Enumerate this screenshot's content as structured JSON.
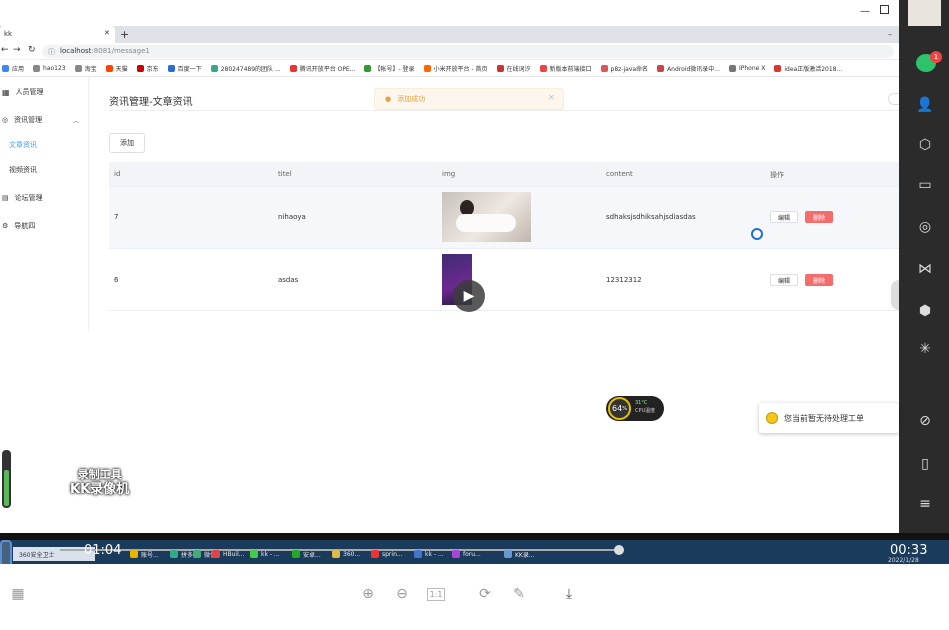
{
  "browser": {
    "tab_title": "kk",
    "url_host": "localhost",
    "url_rest": ":8081/message1",
    "bookmarks": [
      "应用",
      "hao123",
      "淘宝",
      "天猫",
      "京东",
      "百度一下",
      "280247489的团队 ...",
      "腾讯开放平台 OPE...",
      "【帐号】- 登录",
      "小米开放平台 - 首页",
      "在线词汐",
      "新版本前端接口",
      "p8z-java命名",
      "Android微讯录中...",
      "IPhone X",
      "idea正版激活2018..."
    ]
  },
  "sidebar": {
    "items": [
      {
        "label": "人员管理",
        "icon": "grid-icon"
      },
      {
        "label": "资讯管理",
        "icon": "location-icon"
      },
      {
        "label": "文章资讯"
      },
      {
        "label": "视频资讯"
      },
      {
        "label": "论坛管理",
        "icon": "document-icon"
      },
      {
        "label": "导航四",
        "icon": "gear-icon"
      }
    ]
  },
  "page": {
    "title": "资讯管理-文章资讯",
    "toast": "添加成功",
    "add_button": "添加"
  },
  "table": {
    "headers": [
      "id",
      "titel",
      "img",
      "content",
      "操作"
    ],
    "rows": [
      {
        "id": "7",
        "title": "nihaoya",
        "content": "sdhaksjsdhiksahjsdiasdas"
      },
      {
        "id": "6",
        "title": "asdas",
        "content": "12312312"
      }
    ],
    "edit_label": "编辑",
    "delete_label": "删除"
  },
  "overlays": {
    "cpu_percent": "64",
    "cpu_unit": "%",
    "cpu_temp": "31°C",
    "cpu_label": "CPU温度",
    "work_order": "您当前暂无待处理工单",
    "watermark_line1": "录制工具",
    "watermark_line2": "KK录像机",
    "badge_count": "1"
  },
  "player": {
    "current_time": "01:04",
    "end_time": "00:33",
    "progress": 0.65
  },
  "taskbar": {
    "items": [
      "360安全卫士",
      "账号...",
      "拼多...",
      "微信",
      "HBuil...",
      "kk - ...",
      "安卓...",
      "360...",
      "sprin...",
      "kk - ...",
      "foru...",
      "KK录..."
    ],
    "date": "2022/1/28"
  },
  "colors": {
    "accent": "#409eff",
    "danger": "#f56c6c",
    "warning": "#e6a23c",
    "panel": "#2b2b2b"
  }
}
